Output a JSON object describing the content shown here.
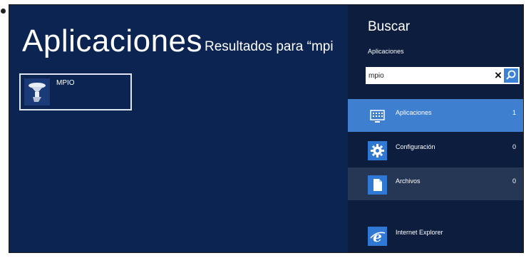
{
  "main": {
    "title": "Aplicaciones",
    "results_label": "Resultados para “mpi",
    "app_results": [
      {
        "label": "MPIO",
        "icon": "mpio-app-icon"
      }
    ]
  },
  "search_pane": {
    "title": "Buscar",
    "scope": "Aplicaciones",
    "query": "mpio",
    "clear_icon": "close-icon",
    "search_icon": "search-icon",
    "categories": [
      {
        "label": "Aplicaciones",
        "count": "1",
        "icon": "apps-grid-icon",
        "state": "selected"
      },
      {
        "label": "Configuración",
        "count": "0",
        "icon": "gear-icon",
        "state": "normal"
      },
      {
        "label": "Archivos",
        "count": "0",
        "icon": "document-icon",
        "state": "hover"
      }
    ],
    "other_apps": [
      {
        "label": "Internet Explorer",
        "icon": "internet-explorer-icon"
      }
    ]
  },
  "colors": {
    "background": "#0b2452",
    "pane": "#0c1d3e",
    "accent": "#3f7fcf",
    "hover": "#253754",
    "icon_tile": "#2f78d4"
  }
}
